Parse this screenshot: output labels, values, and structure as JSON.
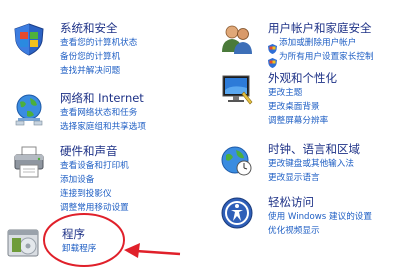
{
  "categories": {
    "system_security": {
      "title": "系统和安全",
      "icon": "shield-flag-icon",
      "links": [
        "查看您的计算机状态",
        "备份您的计算机",
        "查找并解决问题"
      ]
    },
    "network": {
      "title": "网络和 Internet",
      "icon": "network-globe-icon",
      "links": [
        "查看网络状态和任务",
        "选择家庭组和共享选项"
      ]
    },
    "hardware": {
      "title": "硬件和声音",
      "icon": "printer-icon",
      "links": [
        "查看设备和打印机",
        "添加设备",
        "连接到投影仪",
        "调整常用移动设置"
      ]
    },
    "programs": {
      "title": "程序",
      "icon": "programs-icon",
      "links": [
        "卸载程序"
      ]
    },
    "user_accounts": {
      "title": "用户帐户和家庭安全",
      "icon": "users-icon",
      "links": [
        "添加或删除用户帐户",
        "为所有用户设置家长控制"
      ]
    },
    "appearance": {
      "title": "外观和个性化",
      "icon": "display-icon",
      "links": [
        "更改主题",
        "更改桌面背景",
        "调整屏幕分辨率"
      ]
    },
    "clock": {
      "title": "时钟、语言和区域",
      "icon": "clock-globe-icon",
      "links": [
        "更改键盘或其他输入法",
        "更改显示语言"
      ]
    },
    "ease": {
      "title": "轻松访问",
      "icon": "ease-of-access-icon",
      "links": [
        "使用 Windows 建议的设置",
        "优化视频显示"
      ]
    }
  },
  "annotation": {
    "color": "#e0202a"
  }
}
